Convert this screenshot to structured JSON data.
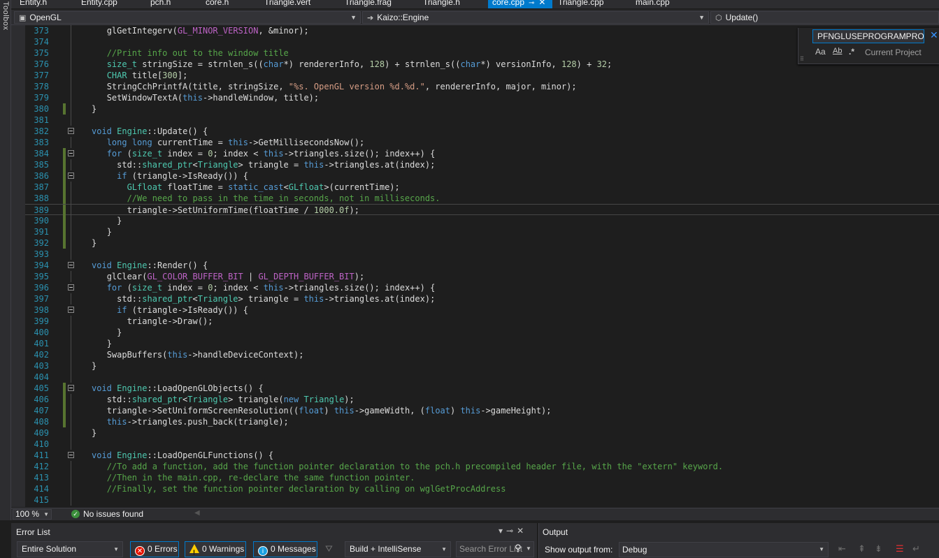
{
  "toolbox": {
    "label": "Toolbox"
  },
  "tabs": [
    {
      "label": "Entity.h",
      "active": false
    },
    {
      "label": "Entity.cpp",
      "active": false
    },
    {
      "label": "pch.h",
      "active": false
    },
    {
      "label": "core.h",
      "active": false
    },
    {
      "label": "Triangle.vert",
      "active": false
    },
    {
      "label": "Triangle.frag",
      "active": false
    },
    {
      "label": "Triangle.h",
      "active": false
    },
    {
      "label": "core.cpp",
      "active": true
    },
    {
      "label": "Triangle.cpp",
      "active": false
    },
    {
      "label": "main.cpp",
      "active": false
    }
  ],
  "nav": {
    "project": "OpenGL",
    "scope": "Kaizo::Engine",
    "member": "Update()"
  },
  "find": {
    "query": "PFNGLUSEPROGRAMPROC",
    "scope": "Current Project",
    "opt_case": "Aa",
    "opt_word": "Ab",
    "opt_regex": ".*"
  },
  "code": {
    "lines": [
      {
        "n": "373",
        "changed": false,
        "fold": false,
        "indent": 1,
        "tokens": [
          [
            "",
            "glGetIntegerv("
          ],
          [
            "mc",
            "GL_MINOR_VERSION"
          ],
          [
            "",
            ", &minor);"
          ]
        ]
      },
      {
        "n": "374",
        "changed": false,
        "fold": false,
        "indent": 1,
        "tokens": []
      },
      {
        "n": "375",
        "changed": false,
        "fold": false,
        "indent": 1,
        "tokens": [
          [
            "cm",
            "//Print info out to the window title"
          ]
        ]
      },
      {
        "n": "376",
        "changed": false,
        "fold": false,
        "indent": 1,
        "tokens": [
          [
            "ty",
            "size_t"
          ],
          [
            "",
            " stringSize = strnlen_s(("
          ],
          [
            "kw",
            "char"
          ],
          [
            "",
            "*) rendererInfo, "
          ],
          [
            "nu",
            "128"
          ],
          [
            "",
            ") + strnlen_s(("
          ],
          [
            "kw",
            "char"
          ],
          [
            "",
            "*) versionInfo, "
          ],
          [
            "nu",
            "128"
          ],
          [
            "",
            ") + "
          ],
          [
            "nu",
            "32"
          ],
          [
            "",
            ";"
          ]
        ]
      },
      {
        "n": "377",
        "changed": false,
        "fold": false,
        "indent": 1,
        "tokens": [
          [
            "ty",
            "CHAR"
          ],
          [
            "",
            " title["
          ],
          [
            "nu",
            "300"
          ],
          [
            "",
            "];"
          ]
        ]
      },
      {
        "n": "378",
        "changed": false,
        "fold": false,
        "indent": 1,
        "tokens": [
          [
            "",
            "StringCchPrintfA(title, stringSize, "
          ],
          [
            "st",
            "\"%s. OpenGL version %d.%d.\""
          ],
          [
            "",
            ", rendererInfo, major, minor);"
          ]
        ]
      },
      {
        "n": "379",
        "changed": false,
        "fold": false,
        "indent": 1,
        "tokens": [
          [
            "",
            "SetWindowTextA("
          ],
          [
            "kw",
            "this"
          ],
          [
            "",
            "->handleWindow, title);"
          ]
        ]
      },
      {
        "n": "380",
        "changed": true,
        "fold": false,
        "indent": 0,
        "tokens": [
          [
            "",
            "}"
          ]
        ]
      },
      {
        "n": "381",
        "changed": false,
        "fold": false,
        "indent": 0,
        "tokens": []
      },
      {
        "n": "382",
        "changed": false,
        "fold": true,
        "indent": 0,
        "tokens": [
          [
            "kw",
            "void"
          ],
          [
            "",
            " "
          ],
          [
            "ty",
            "Engine"
          ],
          [
            "",
            "::Update() {"
          ]
        ]
      },
      {
        "n": "383",
        "changed": false,
        "fold": false,
        "indent": 1,
        "tokens": [
          [
            "kw",
            "long long"
          ],
          [
            "",
            " currentTime = "
          ],
          [
            "kw",
            "this"
          ],
          [
            "",
            "->GetMillisecondsNow();"
          ]
        ]
      },
      {
        "n": "384",
        "changed": true,
        "fold": true,
        "indent": 1,
        "tokens": [
          [
            "kw",
            "for"
          ],
          [
            "",
            " ("
          ],
          [
            "ty",
            "size_t"
          ],
          [
            "",
            " index = "
          ],
          [
            "nu",
            "0"
          ],
          [
            "",
            "; index < "
          ],
          [
            "kw",
            "this"
          ],
          [
            "",
            "->triangles.size(); index++) {"
          ]
        ]
      },
      {
        "n": "385",
        "changed": true,
        "fold": false,
        "indent": 2,
        "tokens": [
          [
            "",
            "std::"
          ],
          [
            "ty",
            "shared_ptr"
          ],
          [
            "",
            "<"
          ],
          [
            "ty",
            "Triangle"
          ],
          [
            "",
            "> triangle = "
          ],
          [
            "kw",
            "this"
          ],
          [
            "",
            "->triangles.at(index);"
          ]
        ]
      },
      {
        "n": "386",
        "changed": true,
        "fold": true,
        "indent": 2,
        "tokens": [
          [
            "kw",
            "if"
          ],
          [
            "",
            " (triangle->IsReady()) {"
          ]
        ]
      },
      {
        "n": "387",
        "changed": true,
        "fold": false,
        "indent": 3,
        "tokens": [
          [
            "ty",
            "GLfloat"
          ],
          [
            "",
            " floatTime = "
          ],
          [
            "kw",
            "static_cast"
          ],
          [
            "",
            "<"
          ],
          [
            "ty",
            "GLfloat"
          ],
          [
            "",
            ">(currentTime);"
          ]
        ]
      },
      {
        "n": "388",
        "changed": true,
        "fold": false,
        "indent": 3,
        "tokens": [
          [
            "cm",
            "//We need to pass in the time in seconds, not in milliseconds."
          ]
        ]
      },
      {
        "n": "389",
        "changed": true,
        "fold": false,
        "indent": 3,
        "current": true,
        "tokens": [
          [
            "",
            "triangle->SetUniformTime(floatTime / "
          ],
          [
            "nu",
            "1000.0f"
          ],
          [
            "",
            ");"
          ]
        ]
      },
      {
        "n": "390",
        "changed": true,
        "fold": false,
        "indent": 2,
        "tokens": [
          [
            "",
            "}"
          ]
        ]
      },
      {
        "n": "391",
        "changed": true,
        "fold": false,
        "indent": 1,
        "tokens": [
          [
            "",
            "}"
          ]
        ]
      },
      {
        "n": "392",
        "changed": true,
        "fold": false,
        "indent": 0,
        "tokens": [
          [
            "",
            "}"
          ]
        ]
      },
      {
        "n": "393",
        "changed": false,
        "fold": false,
        "indent": 0,
        "tokens": []
      },
      {
        "n": "394",
        "changed": false,
        "fold": true,
        "indent": 0,
        "tokens": [
          [
            "kw",
            "void"
          ],
          [
            "",
            " "
          ],
          [
            "ty",
            "Engine"
          ],
          [
            "",
            "::Render() {"
          ]
        ]
      },
      {
        "n": "395",
        "changed": false,
        "fold": false,
        "indent": 1,
        "tokens": [
          [
            "",
            "glClear("
          ],
          [
            "mc",
            "GL_COLOR_BUFFER_BIT"
          ],
          [
            "",
            " | "
          ],
          [
            "mc",
            "GL_DEPTH_BUFFER_BIT"
          ],
          [
            "",
            ");"
          ]
        ]
      },
      {
        "n": "396",
        "changed": false,
        "fold": true,
        "indent": 1,
        "tokens": [
          [
            "kw",
            "for"
          ],
          [
            "",
            " ("
          ],
          [
            "ty",
            "size_t"
          ],
          [
            "",
            " index = "
          ],
          [
            "nu",
            "0"
          ],
          [
            "",
            "; index < "
          ],
          [
            "kw",
            "this"
          ],
          [
            "",
            "->triangles.size(); index++) {"
          ]
        ]
      },
      {
        "n": "397",
        "changed": false,
        "fold": false,
        "indent": 2,
        "tokens": [
          [
            "",
            "std::"
          ],
          [
            "ty",
            "shared_ptr"
          ],
          [
            "",
            "<"
          ],
          [
            "ty",
            "Triangle"
          ],
          [
            "",
            "> triangle = "
          ],
          [
            "kw",
            "this"
          ],
          [
            "",
            "->triangles.at(index);"
          ]
        ]
      },
      {
        "n": "398",
        "changed": false,
        "fold": true,
        "indent": 2,
        "tokens": [
          [
            "kw",
            "if"
          ],
          [
            "",
            " (triangle->IsReady()) {"
          ]
        ]
      },
      {
        "n": "399",
        "changed": false,
        "fold": false,
        "indent": 3,
        "tokens": [
          [
            "",
            "triangle->Draw();"
          ]
        ]
      },
      {
        "n": "400",
        "changed": false,
        "fold": false,
        "indent": 2,
        "tokens": [
          [
            "",
            "}"
          ]
        ]
      },
      {
        "n": "401",
        "changed": false,
        "fold": false,
        "indent": 1,
        "tokens": [
          [
            "",
            "}"
          ]
        ]
      },
      {
        "n": "402",
        "changed": false,
        "fold": false,
        "indent": 1,
        "tokens": [
          [
            "",
            "SwapBuffers("
          ],
          [
            "kw",
            "this"
          ],
          [
            "",
            "->handleDeviceContext);"
          ]
        ]
      },
      {
        "n": "403",
        "changed": false,
        "fold": false,
        "indent": 0,
        "tokens": [
          [
            "",
            "}"
          ]
        ]
      },
      {
        "n": "404",
        "changed": false,
        "fold": false,
        "indent": 0,
        "tokens": []
      },
      {
        "n": "405",
        "changed": true,
        "fold": true,
        "indent": 0,
        "tokens": [
          [
            "kw",
            "void"
          ],
          [
            "",
            " "
          ],
          [
            "ty",
            "Engine"
          ],
          [
            "",
            "::LoadOpenGLObjects() {"
          ]
        ]
      },
      {
        "n": "406",
        "changed": true,
        "fold": false,
        "indent": 1,
        "tokens": [
          [
            "",
            "std::"
          ],
          [
            "ty",
            "shared_ptr"
          ],
          [
            "",
            "<"
          ],
          [
            "ty",
            "Triangle"
          ],
          [
            "",
            "> triangle("
          ],
          [
            "kw",
            "new"
          ],
          [
            "",
            " "
          ],
          [
            "ty",
            "Triangle"
          ],
          [
            "",
            ");"
          ]
        ]
      },
      {
        "n": "407",
        "changed": true,
        "fold": false,
        "indent": 1,
        "tokens": [
          [
            "",
            "triangle->SetUniformScreenResolution(("
          ],
          [
            "kw",
            "float"
          ],
          [
            "",
            ") "
          ],
          [
            "kw",
            "this"
          ],
          [
            "",
            "->gameWidth, ("
          ],
          [
            "kw",
            "float"
          ],
          [
            "",
            ") "
          ],
          [
            "kw",
            "this"
          ],
          [
            "",
            "->gameHeight);"
          ]
        ]
      },
      {
        "n": "408",
        "changed": true,
        "fold": false,
        "indent": 1,
        "tokens": [
          [
            "kw",
            "this"
          ],
          [
            "",
            "->triangles.push_back(triangle);"
          ]
        ]
      },
      {
        "n": "409",
        "changed": false,
        "fold": false,
        "indent": 0,
        "tokens": [
          [
            "",
            "}"
          ]
        ]
      },
      {
        "n": "410",
        "changed": false,
        "fold": false,
        "indent": 0,
        "tokens": []
      },
      {
        "n": "411",
        "changed": false,
        "fold": true,
        "indent": 0,
        "tokens": [
          [
            "kw",
            "void"
          ],
          [
            "",
            " "
          ],
          [
            "ty",
            "Engine"
          ],
          [
            "",
            "::LoadOpenGLFunctions() {"
          ]
        ]
      },
      {
        "n": "412",
        "changed": false,
        "fold": false,
        "indent": 1,
        "tokens": [
          [
            "cm",
            "//To add a function, add the function pointer declaration to the pch.h precompiled header file, with the \"extern\" keyword."
          ]
        ]
      },
      {
        "n": "413",
        "changed": false,
        "fold": false,
        "indent": 1,
        "tokens": [
          [
            "cm",
            "//Then in the main.cpp, re-declare the same function pointer."
          ]
        ]
      },
      {
        "n": "414",
        "changed": false,
        "fold": false,
        "indent": 1,
        "tokens": [
          [
            "cm",
            "//Finally, set the function pointer declaration by calling on wglGetProcAddress"
          ]
        ]
      },
      {
        "n": "415",
        "changed": false,
        "fold": false,
        "indent": 1,
        "tokens": []
      }
    ]
  },
  "status": {
    "zoom": "100 %",
    "issues": "No issues found"
  },
  "error_list": {
    "title": "Error List",
    "scope": "Entire Solution",
    "errors": "0 Errors",
    "warnings": "0 Warnings",
    "messages": "0 Messages",
    "build_filter": "Build + IntelliSense",
    "search_placeholder": "Search Error List"
  },
  "output": {
    "title": "Output",
    "show_from_label": "Show output from:",
    "source": "Debug"
  },
  "colors": {
    "accent": "#007acc",
    "editor_bg": "#1e1e1e",
    "chrome_bg": "#2d2d30",
    "change_marker": "#577430"
  }
}
